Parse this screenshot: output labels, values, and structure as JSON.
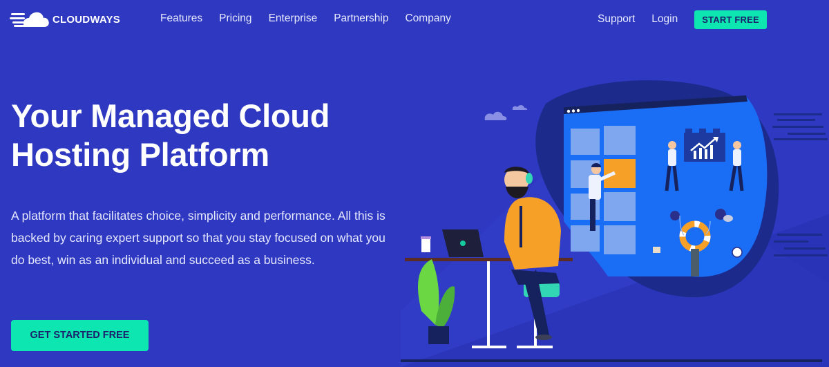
{
  "brand": {
    "name": "CLOUDWAYS",
    "logo_icon": "cloud-speed-icon"
  },
  "nav": {
    "links": [
      {
        "label": "Features"
      },
      {
        "label": "Pricing"
      },
      {
        "label": "Enterprise"
      },
      {
        "label": "Partnership"
      },
      {
        "label": "Company"
      }
    ],
    "support_label": "Support",
    "login_label": "Login",
    "start_free_label": "START FREE"
  },
  "hero": {
    "title_line1": "Your Managed Cloud",
    "title_line2": "Hosting Platform",
    "description": "A platform that facilitates choice, simplicity and performance. All this is backed by caring expert support so that you stay focused on what you do best, win as an individual and succeed as a business.",
    "cta_label": "GET STARTED FREE"
  },
  "colors": {
    "background": "#2e38c0",
    "accent": "#0ee6b1",
    "button_text": "#1b1f6b",
    "panel_blue": "#1a6df5",
    "blob_dark": "#1c2a8c",
    "orange": "#f7a028"
  }
}
